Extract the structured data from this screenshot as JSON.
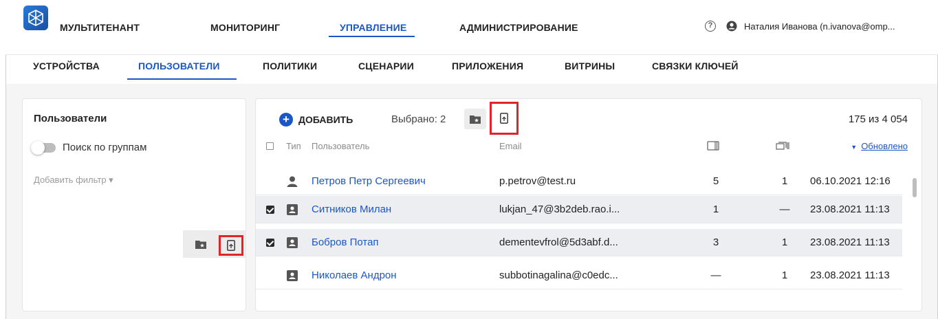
{
  "topnav": {
    "items": [
      {
        "label": "МУЛЬТИТЕНАНТ",
        "active": false
      },
      {
        "label": "МОНИТОРИНГ",
        "active": false
      },
      {
        "label": "УПРАВЛЕНИЕ",
        "active": true
      },
      {
        "label": "АДМИНИСТРИРОВАНИЕ",
        "active": false
      }
    ],
    "help_glyph": "?",
    "user_name": "Наталия Иванова (n.ivanova@omp..."
  },
  "subnav": {
    "items": [
      {
        "label": "УСТРОЙСТВА",
        "active": false
      },
      {
        "label": "ПОЛЬЗОВАТЕЛИ",
        "active": true
      },
      {
        "label": "ПОЛИТИКИ",
        "active": false
      },
      {
        "label": "СЦЕНАРИИ",
        "active": false
      },
      {
        "label": "ПРИЛОЖЕНИЯ",
        "active": false
      },
      {
        "label": "ВИТРИНЫ",
        "active": false
      },
      {
        "label": "СВЯЗКИ КЛЮЧЕЙ",
        "active": false
      }
    ]
  },
  "left_panel": {
    "title": "Пользователи",
    "toggle_label": "Поиск по группам",
    "toggle_on": false,
    "add_filter": "Добавить фильтр ▾"
  },
  "toolbar": {
    "add_label": "ДОБАВИТЬ",
    "selected_text": "Выбрано: 2",
    "count_text": "175 из 4 054"
  },
  "table": {
    "headers": {
      "type": "Тип",
      "user": "Пользователь",
      "email": "Email",
      "sort": "Обновлено"
    },
    "rows": [
      {
        "selected": false,
        "type_icon": "person-icon",
        "name": "Петров Петр Сергеевич",
        "email": "p.petrov@test.ru",
        "devices": "5",
        "keys": "1",
        "updated": "06.10.2021 12:16"
      },
      {
        "selected": true,
        "type_icon": "contact-card-icon",
        "name": "Ситников Милан",
        "email": "lukjan_47@3b2deb.rao.i...",
        "devices": "1",
        "keys": "—",
        "updated": "23.08.2021 11:13"
      },
      {
        "selected": true,
        "type_icon": "contact-card-icon",
        "name": "Бобров Потап",
        "email": "dementevfrol@5d3abf.d...",
        "devices": "3",
        "keys": "1",
        "updated": "23.08.2021 11:13"
      },
      {
        "selected": false,
        "type_icon": "contact-card-icon",
        "name": "Николаев Андрон",
        "email": "subbotinagalina@c0edc...",
        "devices": "—",
        "keys": "1",
        "updated": "23.08.2021 11:13"
      }
    ]
  },
  "colors": {
    "accent": "#1a56c7",
    "highlight": "#e0242c",
    "selected_row": "#eceef1"
  }
}
